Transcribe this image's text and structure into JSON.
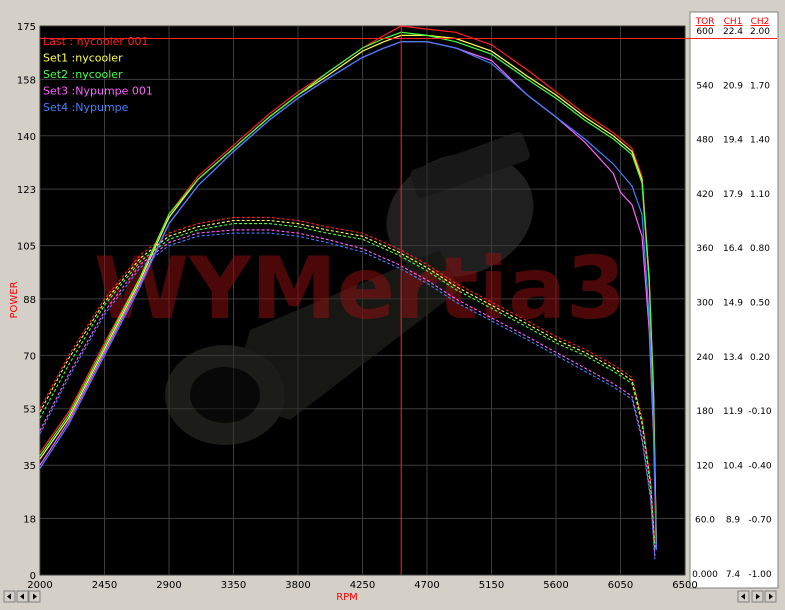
{
  "chart_data": {
    "type": "line",
    "watermark": "WYMertia3",
    "xlabel": "RPM",
    "ylabel": "POWER",
    "x_ticks": [
      "2000",
      "2450",
      "2900",
      "3350",
      "3800",
      "4250",
      "4700",
      "5150",
      "5600",
      "6050",
      "6500"
    ],
    "y_ticks": [
      "0",
      "18",
      "35",
      "53",
      "70",
      "88",
      "105",
      "123",
      "140",
      "158",
      "175"
    ],
    "xlim": [
      2000,
      6500
    ],
    "ylim": [
      0,
      175
    ],
    "cursor_rpm": 4520,
    "cursor_power": 171,
    "right_axes": {
      "headers": [
        "TOR",
        "CH1",
        "CH2"
      ],
      "rows": [
        [
          "600",
          "22.4",
          "2.00"
        ],
        [
          "540",
          "20.9",
          "1.70"
        ],
        [
          "480",
          "19.4",
          "1.40"
        ],
        [
          "420",
          "17.9",
          "1.10"
        ],
        [
          "360",
          "16.4",
          "0.80"
        ],
        [
          "300",
          "14.9",
          "0.50"
        ],
        [
          "240",
          "13.4",
          "0.20"
        ],
        [
          "180",
          "11.9",
          "-0.10"
        ],
        [
          "120",
          "10.4",
          "-0.40"
        ],
        [
          "60.0",
          "8.9",
          "-0.70"
        ],
        [
          "0.000",
          "7.4",
          "-1.00"
        ]
      ]
    },
    "series": [
      {
        "name": "Last : nycooler 001",
        "color": "#ff2020",
        "power": [
          [
            2000,
            39
          ],
          [
            2200,
            52
          ],
          [
            2450,
            74
          ],
          [
            2700,
            95
          ],
          [
            2900,
            115
          ],
          [
            3100,
            127
          ],
          [
            3350,
            137
          ],
          [
            3600,
            147
          ],
          [
            3800,
            154
          ],
          [
            4000,
            160
          ],
          [
            4250,
            168
          ],
          [
            4400,
            172
          ],
          [
            4520,
            175
          ],
          [
            4700,
            174
          ],
          [
            4900,
            173
          ],
          [
            5150,
            169
          ],
          [
            5400,
            161
          ],
          [
            5600,
            154
          ],
          [
            5800,
            147
          ],
          [
            6000,
            141
          ],
          [
            6130,
            136
          ],
          [
            6200,
            127
          ],
          [
            6250,
            95
          ],
          [
            6280,
            60
          ],
          [
            6300,
            12
          ]
        ],
        "torque": [
          [
            2000,
            53
          ],
          [
            2200,
            70
          ],
          [
            2450,
            88
          ],
          [
            2700,
            102
          ],
          [
            2900,
            109
          ],
          [
            3100,
            112
          ],
          [
            3350,
            114
          ],
          [
            3600,
            114
          ],
          [
            3800,
            113
          ],
          [
            4000,
            111
          ],
          [
            4250,
            109
          ],
          [
            4500,
            104
          ],
          [
            4700,
            99
          ],
          [
            4900,
            93
          ],
          [
            5150,
            87
          ],
          [
            5400,
            81
          ],
          [
            5600,
            76
          ],
          [
            5800,
            72
          ],
          [
            6000,
            67
          ],
          [
            6130,
            63
          ],
          [
            6200,
            50
          ],
          [
            6260,
            30
          ],
          [
            6290,
            10
          ]
        ]
      },
      {
        "name": "Set1 :nycooler",
        "color": "#ffff50",
        "power": [
          [
            2000,
            37
          ],
          [
            2200,
            50
          ],
          [
            2450,
            72
          ],
          [
            2700,
            94
          ],
          [
            2900,
            114
          ],
          [
            3100,
            126
          ],
          [
            3350,
            136
          ],
          [
            3600,
            146
          ],
          [
            3800,
            153
          ],
          [
            4000,
            159
          ],
          [
            4250,
            167
          ],
          [
            4400,
            170
          ],
          [
            4520,
            172
          ],
          [
            4700,
            172
          ],
          [
            4900,
            171
          ],
          [
            5150,
            167
          ],
          [
            5400,
            159
          ],
          [
            5600,
            153
          ],
          [
            5800,
            146
          ],
          [
            6000,
            140
          ],
          [
            6130,
            135
          ],
          [
            6200,
            126
          ],
          [
            6250,
            94
          ],
          [
            6280,
            58
          ],
          [
            6300,
            10
          ]
        ],
        "torque": [
          [
            2000,
            52
          ],
          [
            2200,
            69
          ],
          [
            2450,
            87
          ],
          [
            2700,
            101
          ],
          [
            2900,
            108
          ],
          [
            3100,
            111
          ],
          [
            3350,
            113
          ],
          [
            3600,
            113
          ],
          [
            3800,
            112
          ],
          [
            4000,
            110
          ],
          [
            4250,
            108
          ],
          [
            4500,
            103
          ],
          [
            4700,
            98
          ],
          [
            4900,
            92
          ],
          [
            5150,
            86
          ],
          [
            5400,
            80
          ],
          [
            5600,
            75
          ],
          [
            5800,
            71
          ],
          [
            6000,
            66
          ],
          [
            6130,
            62
          ],
          [
            6200,
            49
          ],
          [
            6260,
            29
          ],
          [
            6290,
            9
          ]
        ]
      },
      {
        "name": "Set2 :nycooler",
        "color": "#40ff40",
        "power": [
          [
            2000,
            38
          ],
          [
            2200,
            51
          ],
          [
            2450,
            73
          ],
          [
            2700,
            95
          ],
          [
            2900,
            115
          ],
          [
            3100,
            126
          ],
          [
            3350,
            136
          ],
          [
            3600,
            146
          ],
          [
            3800,
            153
          ],
          [
            4000,
            160
          ],
          [
            4250,
            168
          ],
          [
            4400,
            171
          ],
          [
            4520,
            173
          ],
          [
            4700,
            172
          ],
          [
            4900,
            170
          ],
          [
            5150,
            166
          ],
          [
            5400,
            158
          ],
          [
            5600,
            152
          ],
          [
            5800,
            145
          ],
          [
            6000,
            139
          ],
          [
            6130,
            134
          ],
          [
            6200,
            125
          ],
          [
            6250,
            93
          ],
          [
            6280,
            57
          ],
          [
            6300,
            9
          ]
        ],
        "torque": [
          [
            2000,
            50
          ],
          [
            2200,
            67
          ],
          [
            2450,
            86
          ],
          [
            2700,
            100
          ],
          [
            2900,
            107
          ],
          [
            3100,
            110
          ],
          [
            3350,
            112
          ],
          [
            3600,
            112
          ],
          [
            3800,
            111
          ],
          [
            4000,
            109
          ],
          [
            4250,
            107
          ],
          [
            4500,
            102
          ],
          [
            4700,
            97
          ],
          [
            4900,
            91
          ],
          [
            5150,
            85
          ],
          [
            5400,
            79
          ],
          [
            5600,
            74
          ],
          [
            5800,
            70
          ],
          [
            6000,
            65
          ],
          [
            6130,
            61
          ],
          [
            6200,
            48
          ],
          [
            6260,
            28
          ],
          [
            6290,
            8
          ]
        ]
      },
      {
        "name": "Set3 :Nypumpe 001",
        "color": "#ff60ff",
        "power": [
          [
            2000,
            35
          ],
          [
            2200,
            49
          ],
          [
            2450,
            71
          ],
          [
            2700,
            93
          ],
          [
            2900,
            112
          ],
          [
            3100,
            124
          ],
          [
            3350,
            135
          ],
          [
            3600,
            145
          ],
          [
            3800,
            152
          ],
          [
            4000,
            158
          ],
          [
            4250,
            165
          ],
          [
            4400,
            168
          ],
          [
            4520,
            170
          ],
          [
            4700,
            170
          ],
          [
            4900,
            168
          ],
          [
            5150,
            164
          ],
          [
            5400,
            153
          ],
          [
            5600,
            146
          ],
          [
            5800,
            138
          ],
          [
            6000,
            128
          ],
          [
            6050,
            122
          ],
          [
            6130,
            118
          ],
          [
            6200,
            108
          ],
          [
            6250,
            78
          ],
          [
            6280,
            45
          ],
          [
            6300,
            8
          ]
        ],
        "torque": [
          [
            2000,
            46
          ],
          [
            2200,
            64
          ],
          [
            2450,
            84
          ],
          [
            2700,
            99
          ],
          [
            2900,
            106
          ],
          [
            3100,
            109
          ],
          [
            3350,
            110
          ],
          [
            3600,
            110
          ],
          [
            3800,
            109
          ],
          [
            4000,
            107
          ],
          [
            4250,
            104
          ],
          [
            4500,
            99
          ],
          [
            4700,
            94
          ],
          [
            4900,
            88
          ],
          [
            5150,
            82
          ],
          [
            5400,
            76
          ],
          [
            5600,
            71
          ],
          [
            5800,
            66
          ],
          [
            6000,
            61
          ],
          [
            6130,
            57
          ],
          [
            6200,
            44
          ],
          [
            6260,
            25
          ],
          [
            6290,
            6
          ]
        ]
      },
      {
        "name": "Set4 :Nypumpe",
        "color": "#4080ff",
        "power": [
          [
            2000,
            34
          ],
          [
            2200,
            48
          ],
          [
            2450,
            70
          ],
          [
            2700,
            92
          ],
          [
            2900,
            112
          ],
          [
            3100,
            124
          ],
          [
            3350,
            135
          ],
          [
            3600,
            145
          ],
          [
            3800,
            152
          ],
          [
            4000,
            158
          ],
          [
            4250,
            165
          ],
          [
            4400,
            168
          ],
          [
            4520,
            170
          ],
          [
            4700,
            170
          ],
          [
            4900,
            168
          ],
          [
            5150,
            163
          ],
          [
            5400,
            153
          ],
          [
            5600,
            146
          ],
          [
            5800,
            139
          ],
          [
            6000,
            131
          ],
          [
            6130,
            124
          ],
          [
            6200,
            115
          ],
          [
            6250,
            82
          ],
          [
            6280,
            48
          ],
          [
            6300,
            8
          ]
        ],
        "torque": [
          [
            2000,
            45
          ],
          [
            2200,
            63
          ],
          [
            2450,
            83
          ],
          [
            2700,
            98
          ],
          [
            2900,
            105
          ],
          [
            3100,
            108
          ],
          [
            3350,
            109
          ],
          [
            3600,
            109
          ],
          [
            3800,
            108
          ],
          [
            4000,
            106
          ],
          [
            4250,
            103
          ],
          [
            4500,
            98
          ],
          [
            4700,
            93
          ],
          [
            4900,
            87
          ],
          [
            5150,
            81
          ],
          [
            5400,
            75
          ],
          [
            5600,
            70
          ],
          [
            5800,
            65
          ],
          [
            6000,
            60
          ],
          [
            6130,
            56
          ],
          [
            6200,
            43
          ],
          [
            6260,
            24
          ],
          [
            6290,
            5
          ]
        ]
      }
    ]
  }
}
